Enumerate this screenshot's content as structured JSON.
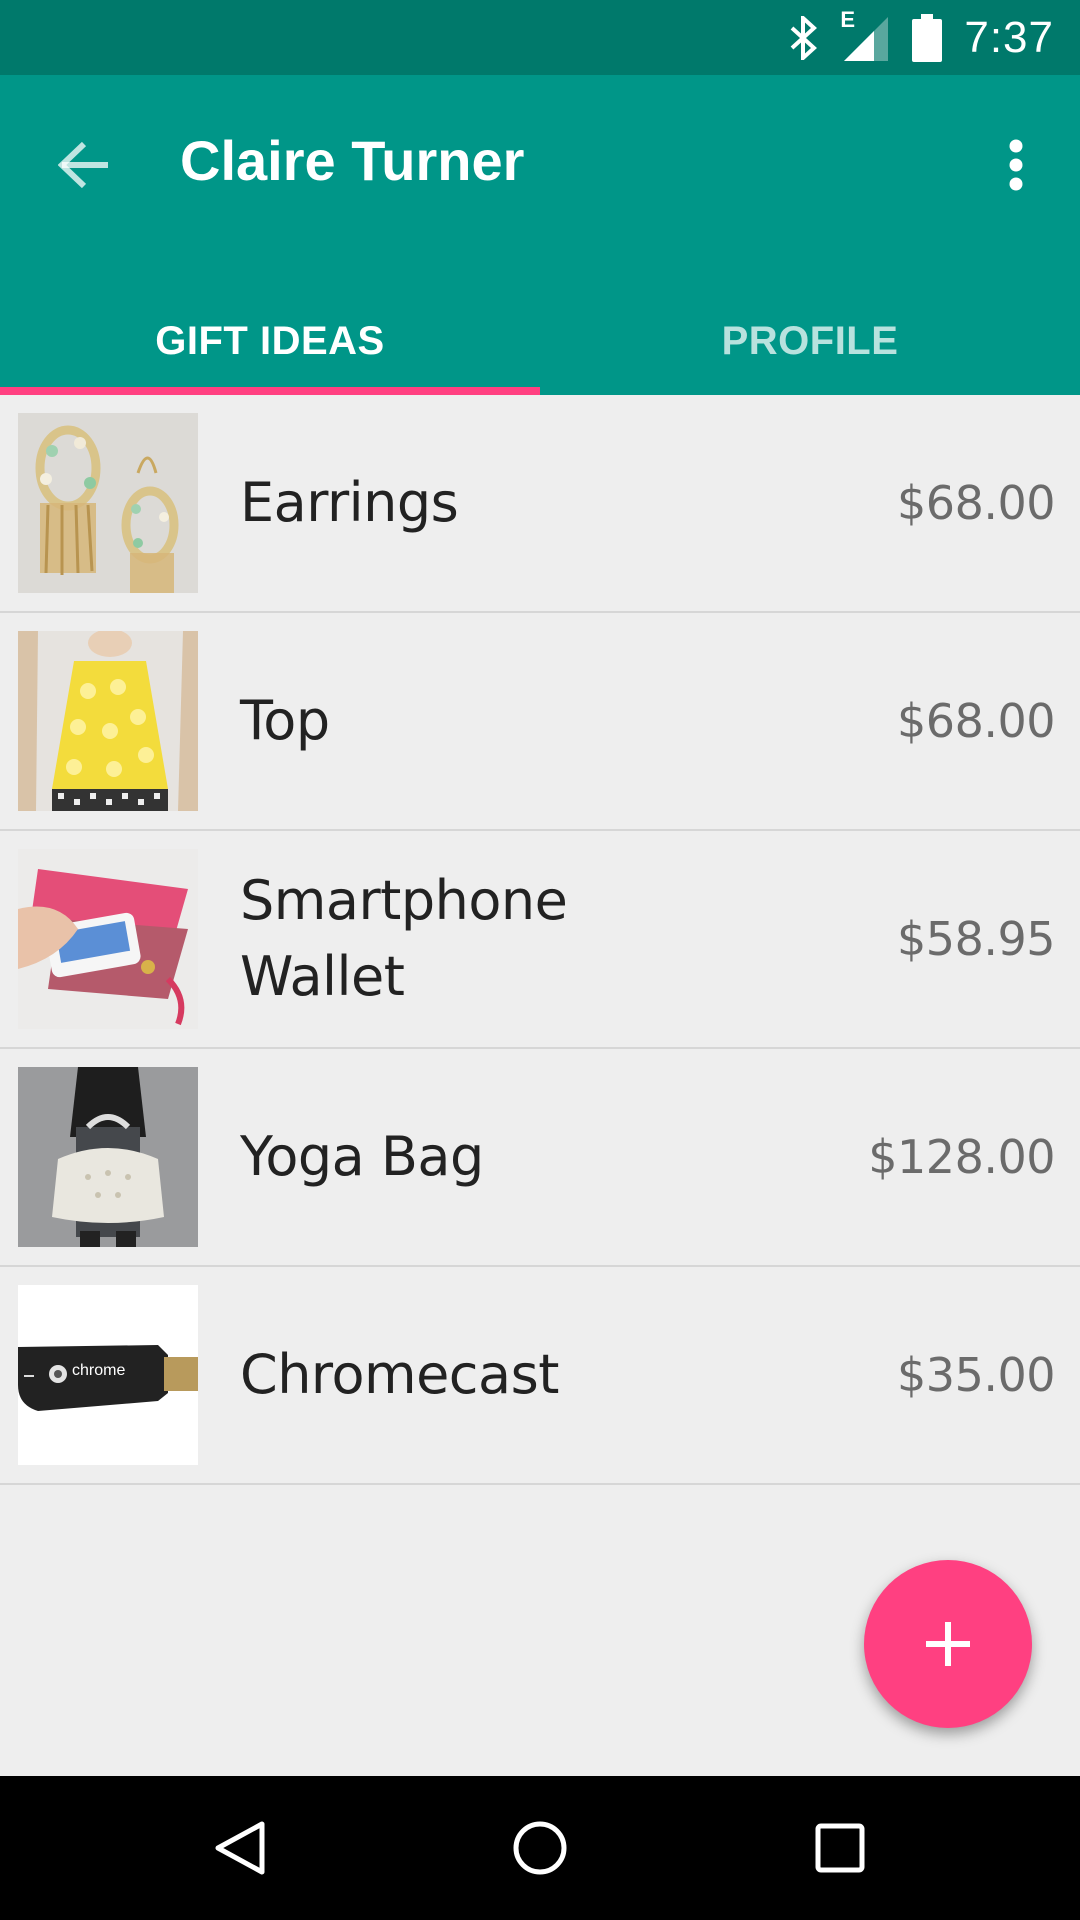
{
  "status_bar": {
    "time": "7:37",
    "network_label": "E",
    "icons": [
      "bluetooth-icon",
      "signal-icon",
      "battery-icon"
    ]
  },
  "app_bar": {
    "title": "Claire Turner",
    "back_icon": "arrow-back-icon",
    "menu_icon": "more-vert-icon"
  },
  "tabs": [
    {
      "label": "GIFT IDEAS",
      "selected": true
    },
    {
      "label": "PROFILE",
      "selected": false
    }
  ],
  "gifts": [
    {
      "name": "Earrings",
      "price": "$68.00",
      "image": "earrings-photo"
    },
    {
      "name": "Top",
      "price": "$68.00",
      "image": "top-photo"
    },
    {
      "name": "Smartphone Wallet",
      "price": "$58.95",
      "image": "wallet-photo"
    },
    {
      "name": "Yoga Bag",
      "price": "$128.00",
      "image": "yoga-bag-photo"
    },
    {
      "name": "Chromecast",
      "price": "$35.00",
      "image": "chromecast-photo",
      "image_text": "chrome"
    }
  ],
  "fab": {
    "icon": "add-icon"
  },
  "nav_bar": {
    "icons": [
      "back-triangle-icon",
      "home-circle-icon",
      "recents-square-icon"
    ]
  },
  "colors": {
    "status_bar": "#00796b",
    "primary": "#009688",
    "accent": "#ff4081",
    "background": "#eeeeee"
  }
}
